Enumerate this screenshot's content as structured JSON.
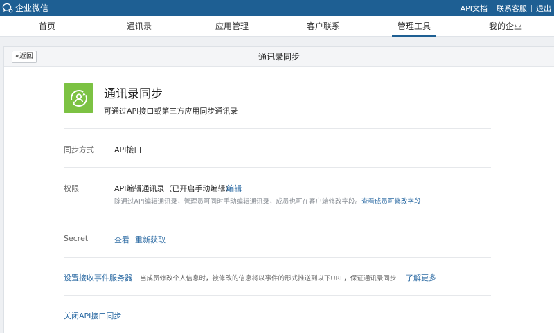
{
  "topbar": {
    "logo_text": "企业微信",
    "links": [
      "API文档",
      "联系客服",
      "退出"
    ]
  },
  "nav": {
    "items": [
      "首页",
      "通讯录",
      "应用管理",
      "客户联系",
      "管理工具",
      "我的企业"
    ],
    "active": "管理工具"
  },
  "panel": {
    "back_label": "«返回",
    "title": "通讯录同步"
  },
  "app": {
    "name": "通讯录同步",
    "description": "可通过API接口或第三方应用同步通讯录"
  },
  "sync_method": {
    "label": "同步方式",
    "value": "API接口"
  },
  "permission": {
    "label": "权限",
    "value": "API编辑通讯录（已开启手动编辑）",
    "edit_link": "编辑",
    "note": "除通过API编辑通讯录，管理员可同时手动编辑通讯录，成员也可在客户端修改字段。",
    "note_link": "查看成员可修改字段"
  },
  "secret": {
    "label": "Secret",
    "view_link": "查看",
    "refresh_link": "重新获取"
  },
  "event_server": {
    "link": "设置接收事件服务器",
    "description": "当成员修改个人信息时，被修改的信息将以事件的形式推送到以下URL，保证通讯录同步",
    "more_link": "了解更多"
  },
  "close_api": {
    "link": "关闭API接口同步"
  },
  "colors": {
    "topbar": "#1e5f93",
    "link": "#2b6aa3",
    "app_icon": "#7cc243"
  }
}
